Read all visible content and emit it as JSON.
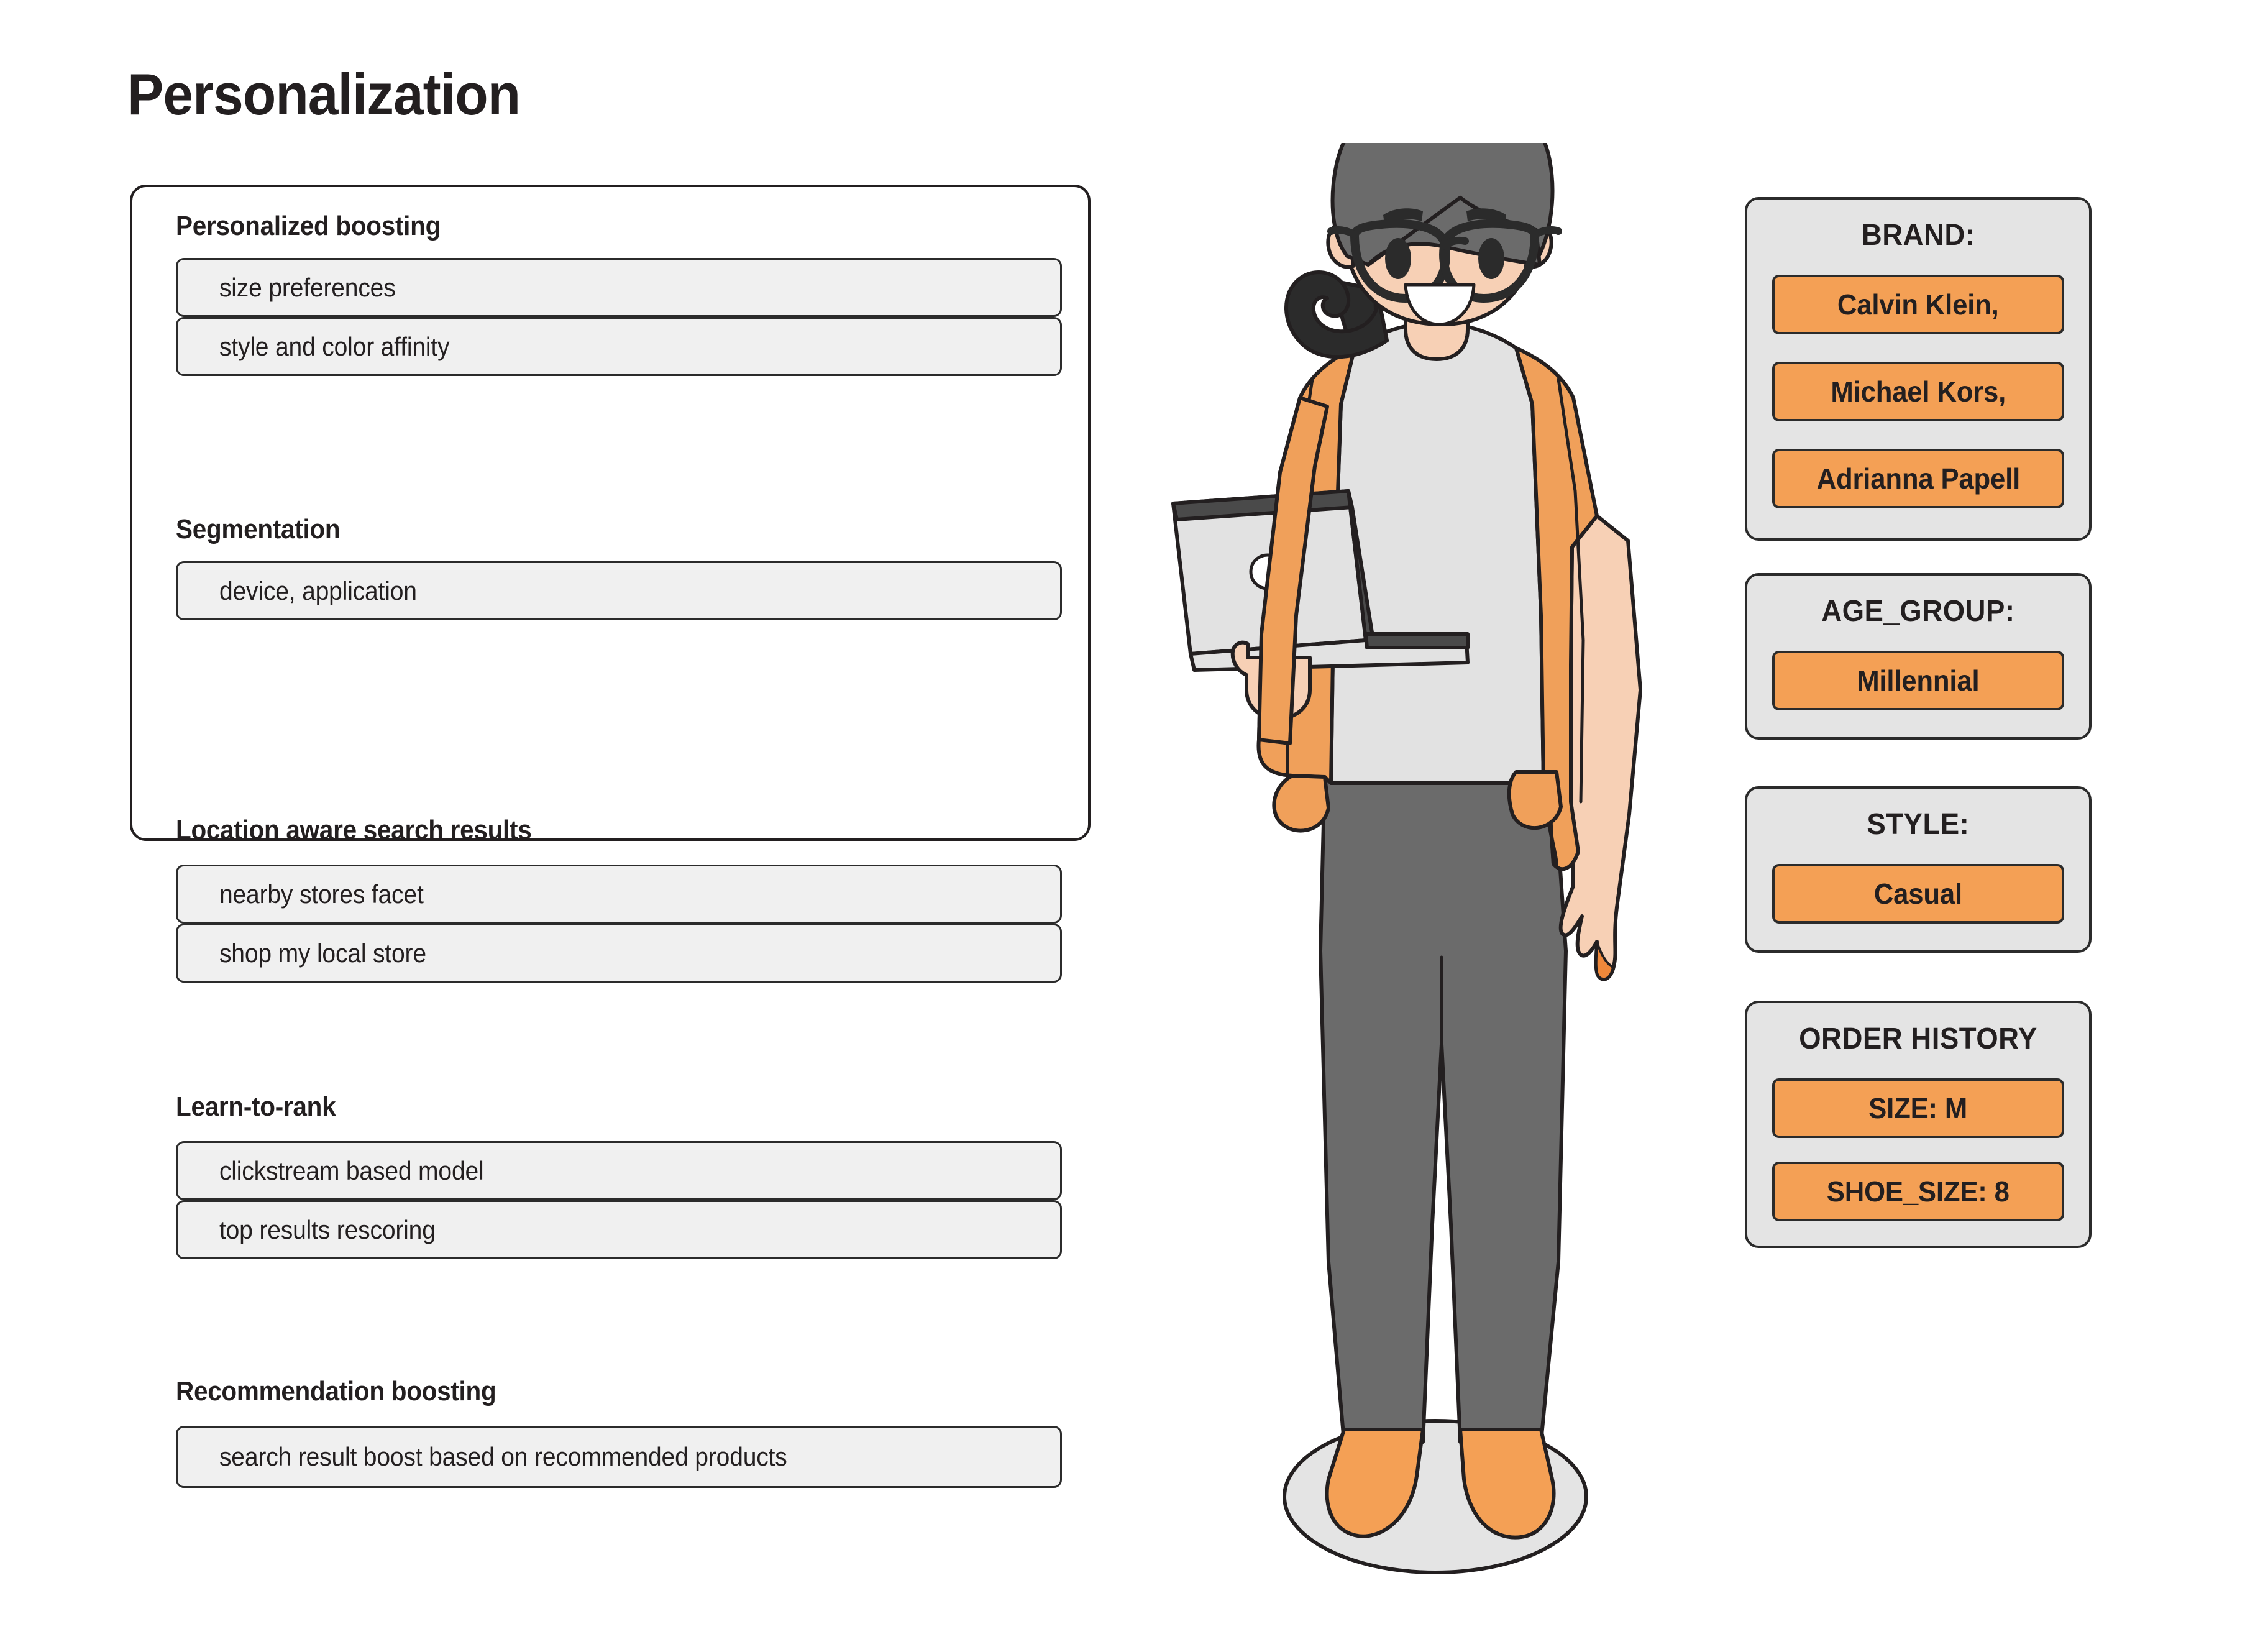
{
  "page": {
    "title": "Personalization"
  },
  "panel": {
    "groups": [
      {
        "title": "Personalized boosting",
        "items": [
          "size preferences",
          "style and color affinity"
        ]
      },
      {
        "title": "Segmentation",
        "items": [
          "device, application"
        ]
      },
      {
        "title": "Location aware search results",
        "items": [
          "nearby stores facet",
          "shop my local store"
        ]
      },
      {
        "title": "Learn-to-rank",
        "items": [
          "clickstream based model",
          "top results rescoring"
        ]
      },
      {
        "title": "Recommendation boosting",
        "items": [
          "search result boost based on recommended products"
        ]
      }
    ]
  },
  "attribute_cards": [
    {
      "title": "BRAND:",
      "values": [
        "Calvin Klein,",
        "Michael Kors,",
        "Adrianna Papell"
      ]
    },
    {
      "title": "AGE_GROUP:",
      "values": [
        "Millennial"
      ]
    },
    {
      "title": "STYLE:",
      "values": [
        "Casual"
      ]
    },
    {
      "title": "ORDER HISTORY",
      "values": [
        "SIZE: M",
        "SHOE_SIZE: 8"
      ]
    }
  ],
  "illustration": {
    "name": "woman-with-laptop-illustration",
    "parts": [
      "hair-bun",
      "hair",
      "glasses",
      "face",
      "smile",
      "orange-jacket",
      "white-top",
      "laptop",
      "hand",
      "gray-pants",
      "orange-shoes",
      "gray-floor-ellipse"
    ]
  },
  "colors": {
    "accent_orange": "#f4a055",
    "jacket_orange": "#f0a05a",
    "card_gray": "#e4e4e4",
    "item_gray": "#f0f0f0",
    "outline": "#231f20",
    "hair_gray": "#6b6b6b",
    "hair_dark": "#2b2b2b",
    "skin": "#f7d0b5",
    "pants_gray": "#6b6b6b",
    "top_gray": "#e2e2e2",
    "background": "#ffffff"
  }
}
